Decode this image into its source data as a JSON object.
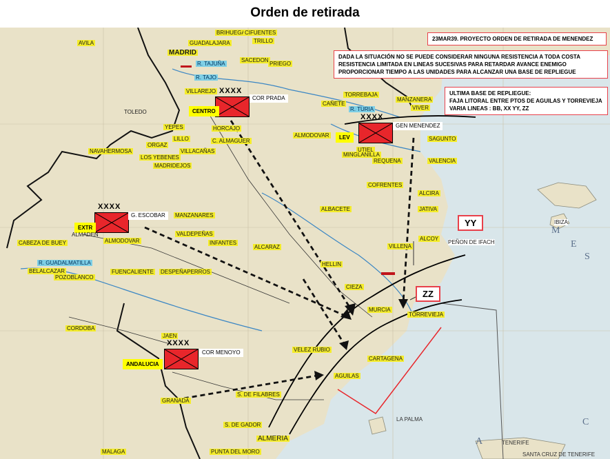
{
  "title": "Orden de retirada",
  "header_box": "23MAR39. PROYECTO ORDEN DE RETIRADA DE MENENDEZ",
  "situation_box": {
    "line1": "DADA LA SITUACIÓN NO SE PUEDE CONSIDERAR NINGUNA RESISTENCIA A TODA COSTA",
    "line2": "RESISTENCIA LIMITADA EN LINEAS SUCESIVAS PARA RETARDAR AVANCE ENEMIGO",
    "line3": "PROPORCIONAR  TIEMPO A LAS UNIDADES PARA ALCANZAR  UNA BASE DE REPLIEGUE"
  },
  "base_box": {
    "line1": "ULTIMA BASE DE REPLIEGUE:",
    "line2": "FAJA LITORAL ENTRE PTOS DE AGUILAS Y TORREVIEJA",
    "line3": "VARIA LINEAS : BB, XX YY, ZZ"
  },
  "defense_lines": {
    "yy": "YY",
    "zz": "ZZ"
  },
  "units": {
    "centro": {
      "tag": "CENTRO",
      "echelon": "XXXX",
      "name": "COR PRADA"
    },
    "lev": {
      "tag": "LEV",
      "echelon": "XXXX",
      "name": "GEN MENENDEZ"
    },
    "extr": {
      "tag": "EXTR",
      "echelon": "XXXX",
      "name": "G. ESCOBAR"
    },
    "andalucia": {
      "tag": "ANDALUCIA",
      "echelon": "XXXX",
      "name": "COR MENOYO"
    }
  },
  "places": {
    "avila": "AVILA",
    "guadalajara": "GUADALAJARA",
    "brihuega": "BRIHUEGA",
    "cifuentes": "CIFUENTES",
    "trillo": "TRILLO",
    "madrid": "MADRID",
    "sacedon": "SACEDON",
    "priego": "PRIEGO",
    "villarejo": "VILLAREJO",
    "toledo": "TOLEDO",
    "yepes": "YEPES",
    "horcajo": "HORCAJO",
    "lillo": "LILLO",
    "orgaz": "ORGAZ",
    "c_almaguer": "C. ALMAGUER",
    "navahermosa": "NAVAHERMOSA",
    "villacanas": "VILLACAÑAS",
    "los_yebenes": "LOS YEBENES",
    "madridejos": "MADRIDEJOS",
    "torrebaja": "TORREBAJA",
    "canete": "CAÑETE",
    "manzanera": "MANZANERA",
    "viver": "VIVER",
    "almodovar": "ALMODOVAR",
    "utiel": "UTIEL",
    "sagunto": "SAGUNTO",
    "minglanilla": "MINGLANILLA",
    "requena": "REQUENA",
    "valencia": "VALENCIA",
    "cofrentes": "COFRENTES",
    "alcira": "ALCIRA",
    "albacete": "ALBACETE",
    "jativa": "JATIVA",
    "ibiza": "IBIZA",
    "manzanares": "MANZANARES",
    "almaden": "ALMADEN",
    "almodovar_sur": "ALMODOVAR",
    "valdepenas": "VALDEPEÑAS",
    "infantes": "INFANTES",
    "alcaraz": "ALCARAZ",
    "alcoy": "ALCOY",
    "villena": "VILLENA",
    "penon_de_ifach": "PEÑON DE IFACH",
    "cabeza_de_buey": "CABEZA DE BUEY",
    "belalcazar": "BELALCAZAR",
    "pozoblanco": "POZOBLANCO",
    "fuencaliente": "FUENCALIENTE",
    "despenaperros": "DESPEÑAPERROS",
    "hellin": "HELLIN",
    "cieza": "CIEZA",
    "murcia": "MURCIA",
    "torrevieja": "TORREVIEJA",
    "cordoba": "CORDOBA",
    "jaen": "JAEN",
    "velez_rubio": "VELEZ RUBIO",
    "cartagena": "CARTAGENA",
    "aguilas": "AGUILAS",
    "granada": "GRANADA",
    "s_de_filabres": "S. DE FILABRES",
    "s_de_gador": "S. DE GADOR",
    "almeria": "ALMERIA",
    "malaga": "MALAGA",
    "punta_del_moro": "PUNTA DEL MORO",
    "la_palma": "LA PALMA",
    "tenerife": "TENERIFE",
    "santa_cruz_de_tenerife": "SANTA CRUZ DE TENERIFE"
  },
  "rivers": {
    "tajuna": "R. TAJUÑA",
    "tajo": "R. TAJO",
    "turia": "R. TURIA",
    "guadalmatilla": "R. GUADALMATILLA"
  },
  "sea_letters": [
    "M",
    "E",
    "S",
    "A",
    "C"
  ],
  "colors": {
    "unit_symbol": "#e8262b",
    "unit_tag": "#ffff00",
    "box_border": "#e8404a",
    "city_label": "#f4ec2a",
    "river_label": "#7ecfe6",
    "sea": "#d9e6ea",
    "land": "#e9e2c8"
  }
}
